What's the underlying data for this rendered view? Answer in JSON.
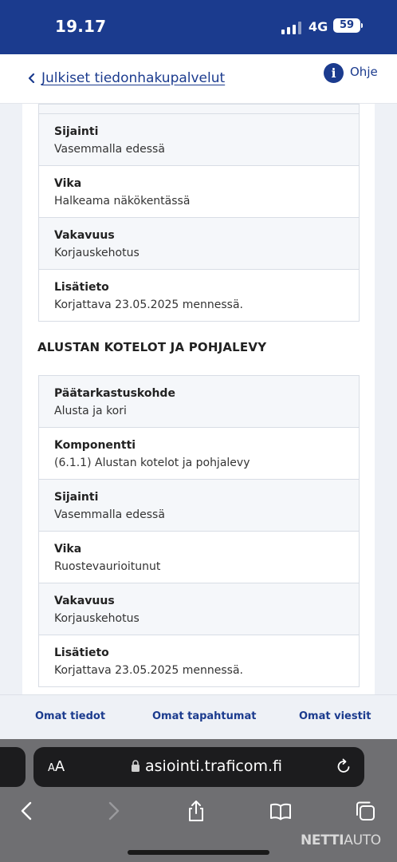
{
  "status_bar": {
    "time": "19.17",
    "network": "4G",
    "battery": "59"
  },
  "header": {
    "back_label": "Julkiset tiedonhakupalvelut",
    "help_label": "Ohje",
    "help_icon": "i"
  },
  "card1": {
    "rows": [
      {
        "label": "Sijainti",
        "value": "Vasemmalla edessä"
      },
      {
        "label": "Vika",
        "value": "Halkeama näkökentässä"
      },
      {
        "label": "Vakavuus",
        "value": "Korjauskehotus"
      },
      {
        "label": "Lisätieto",
        "value": "Korjattava 23.05.2025 mennessä."
      }
    ]
  },
  "section": {
    "title": "ALUSTAN KOTELOT JA POHJALEVY"
  },
  "card2": {
    "rows": [
      {
        "label": "Päätarkastuskohde",
        "value": "Alusta ja kori"
      },
      {
        "label": "Komponentti",
        "value": "(6.1.1) Alustan kotelot ja pohjalevy"
      },
      {
        "label": "Sijainti",
        "value": "Vasemmalla edessä"
      },
      {
        "label": "Vika",
        "value": "Ruostevaurioitunut"
      },
      {
        "label": "Vakavuus",
        "value": "Korjauskehotus"
      },
      {
        "label": "Lisätieto",
        "value": "Korjattava 23.05.2025 mennessä."
      }
    ]
  },
  "bottom_nav": {
    "items": [
      {
        "label": "Omat tiedot"
      },
      {
        "label": "Omat tapahtumat"
      },
      {
        "label": "Omat viestit"
      }
    ]
  },
  "browser": {
    "aa_small": "A",
    "aa_large": "A",
    "url": "asiointi.traficom.fi",
    "watermark_bold": "NETTI",
    "watermark_light": "AUTO"
  },
  "colors": {
    "brand": "#1b3b8e",
    "page_bg": "#eef1f6",
    "row_alt": "#f5f7fa",
    "border": "#d8dde5"
  }
}
